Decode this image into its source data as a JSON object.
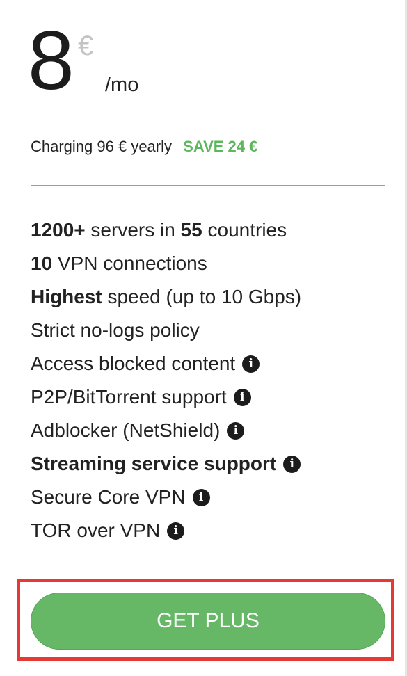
{
  "price": {
    "amount": "8",
    "currency": "€",
    "period": "/mo"
  },
  "billing": {
    "text": "Charging 96 € yearly",
    "save": "SAVE 24 €"
  },
  "features": [
    {
      "bold": "1200+",
      "text": " servers in ",
      "bold2": "55",
      "text2": " countries"
    },
    {
      "bold": "10",
      "text": " VPN connections"
    },
    {
      "bold": "Highest",
      "text": " speed (up to 10 Gbps)"
    },
    {
      "text": "Strict no-logs policy"
    },
    {
      "text": "Access blocked content",
      "icon": "info-icon"
    },
    {
      "text": "P2P/BitTorrent support",
      "icon": "info-icon"
    },
    {
      "text": "Adblocker (NetShield)",
      "icon": "info-icon"
    },
    {
      "bold": "Streaming service support",
      "icon": "info-icon"
    },
    {
      "text": "Secure Core VPN",
      "icon": "info-icon"
    },
    {
      "text": "TOR over VPN",
      "icon": "info-icon"
    }
  ],
  "info_glyph": "i",
  "cta": {
    "label": "GET PLUS",
    "highlight": "red outline box"
  },
  "colors": {
    "accent": "#5cb85c",
    "button": "#66b866",
    "highlight": "#e53935",
    "currency": "#c4c4c4"
  }
}
